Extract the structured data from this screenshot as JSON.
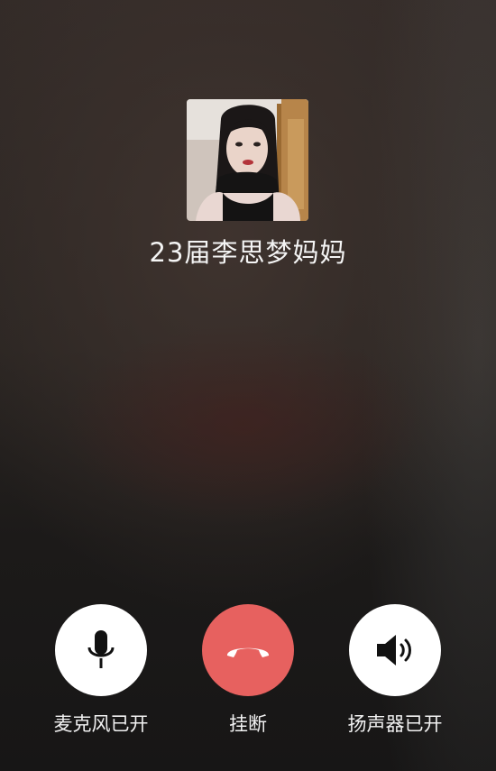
{
  "call": {
    "caller_name": "23届李思梦妈妈",
    "avatar": "caller-photo"
  },
  "controls": [
    {
      "label": "麦克风已开",
      "icon": "microphone-icon",
      "color": "#ffffff",
      "state": "on"
    },
    {
      "label": "挂断",
      "icon": "hang-up-phone-icon",
      "color": "#e7615f"
    },
    {
      "label": "扬声器已开",
      "icon": "speaker-icon",
      "color": "#ffffff",
      "state": "on"
    }
  ]
}
